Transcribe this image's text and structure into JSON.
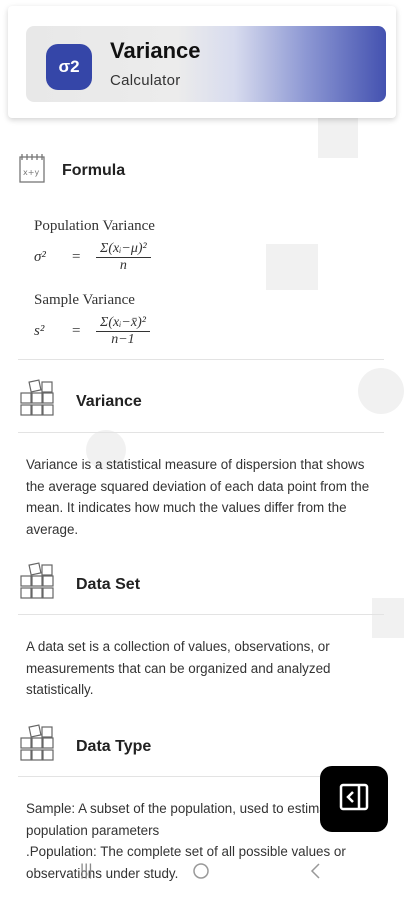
{
  "header": {
    "logo_text": "σ2",
    "title": "Variance",
    "subtitle": "Calculator"
  },
  "formula": {
    "title": "Formula",
    "population": {
      "label": "Population Variance",
      "lhs": "σ²",
      "eq": "=",
      "numerator": "Σ(xᵢ−μ)²",
      "denominator": "n"
    },
    "sample": {
      "label": "Sample Variance",
      "lhs": "s²",
      "eq": "=",
      "numerator": "Σ(xᵢ−x̄)²",
      "denominator": "n−1"
    }
  },
  "sections": [
    {
      "title": "Variance",
      "body": "Variance is a statistical measure of dispersion that shows the average squared deviation of each data point from the mean. It indicates how much the values differ from the average."
    },
    {
      "title": "Data Set",
      "body": "A data set is a collection of values, observations, or measurements that can be organized and analyzed statistically."
    },
    {
      "title": "Data Type",
      "body": "Sample: A subset of the population, used to estimate population parameters\n.Population: The complete set of all possible values or observations under study."
    }
  ],
  "icons": {
    "formula": "calculator-notepad-icon",
    "section": "number-blocks-icon",
    "fab": "collapse-panel-icon",
    "nav": [
      "recents-icon",
      "home-icon",
      "back-icon"
    ]
  },
  "colors": {
    "accent": "#3546a8"
  }
}
